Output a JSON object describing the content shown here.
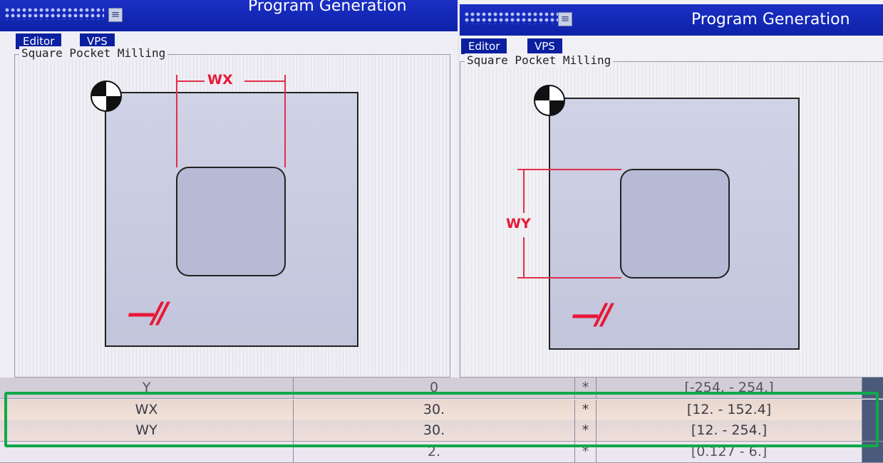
{
  "left_panel": {
    "title": "Program Generation",
    "tabs": [
      "Editor",
      "VPS"
    ],
    "group_label": "Square Pocket Milling",
    "dimension_label": "WX"
  },
  "right_panel": {
    "title": "Program Generation",
    "tabs": [
      "Editor",
      "VPS"
    ],
    "group_label": "Square Pocket Milling",
    "dimension_label": "WY"
  },
  "icons": [
    "menu-icon",
    "work-origin-icon",
    "haas-logo"
  ],
  "colors": {
    "titlebar": "#1b2fc4",
    "dimension": "#e81837",
    "highlight": "#11a84a"
  },
  "parameters": {
    "rows": [
      {
        "name": "Y",
        "value": "0",
        "marker": "*",
        "range": "[-254. - 254.]"
      },
      {
        "name": "WX",
        "value": "30.",
        "marker": "*",
        "range": "[12. - 152.4]"
      },
      {
        "name": "WY",
        "value": "30.",
        "marker": "*",
        "range": "[12. - 254.]"
      },
      {
        "name": "",
        "value": "2.",
        "marker": "*",
        "range": "[0.127 - 6.]"
      }
    ]
  }
}
